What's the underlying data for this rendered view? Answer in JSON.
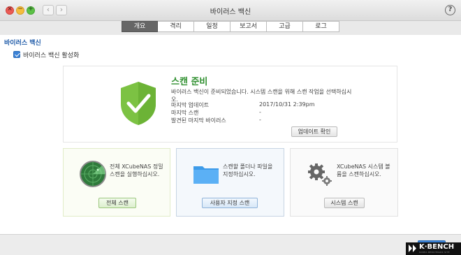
{
  "window": {
    "title": "바이러스 백신",
    "close_glyph": "×",
    "minimize_glyph": "−",
    "maximize_glyph": "+",
    "back_glyph": "‹",
    "forward_glyph": "›",
    "help_glyph": "?"
  },
  "tabs": [
    {
      "label": "개요",
      "active": true
    },
    {
      "label": "격리",
      "active": false
    },
    {
      "label": "일정",
      "active": false
    },
    {
      "label": "보고서",
      "active": false
    },
    {
      "label": "고급",
      "active": false
    },
    {
      "label": "로그",
      "active": false
    }
  ],
  "section": {
    "title": "바이러스 백신",
    "enable_label": "바이러스 백신 활성화",
    "enable_checked": true
  },
  "status": {
    "title": "스캔 준비",
    "message": "바이러스 백신이 준비되었습니다. 시스템 스캔을 위해 스캔 작업을 선택하십시오.",
    "rows": [
      {
        "label": "마지막 업데이트",
        "value": "2017/10/31 2:39pm"
      },
      {
        "label": "마지막 스캔",
        "value": "-"
      },
      {
        "label": "발견된 마지막 바이러스",
        "value": "-"
      }
    ],
    "update_button": "업데이트 확인"
  },
  "cards": {
    "full": {
      "icon": "radar-icon",
      "text": "전체 XCubeNAS 정밀 스캔을 실행하십시오.",
      "button": "전체 스캔"
    },
    "custom": {
      "icon": "folder-icon",
      "text": "스캔할 폴더나 파일을 지정하십시오.",
      "button": "사용자 지정 스캔"
    },
    "system": {
      "icon": "gears-icon",
      "text": "XCubeNAS 시스템 볼륨을 스캔하십시오.",
      "button": "시스템 스캔"
    }
  },
  "footer": {
    "apply_label": "적용"
  },
  "watermark": {
    "brand": "K·BENCH",
    "tagline": "KOREA BENCHMARK SITE"
  },
  "colors": {
    "accent": "#3b82d6",
    "ready_green": "#2f8f2f",
    "shield_green": "#7cc243",
    "section_title": "#1e5aa8"
  }
}
